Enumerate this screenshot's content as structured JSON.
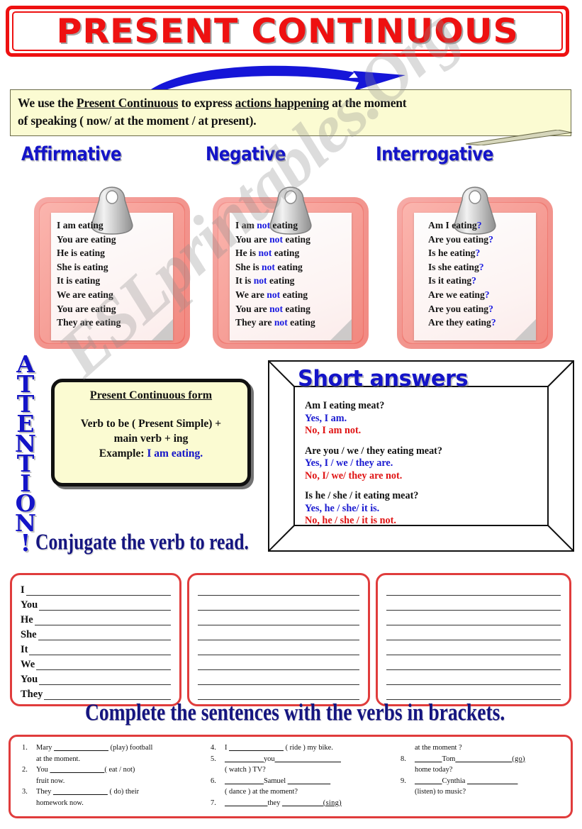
{
  "title": {
    "text": "PRESENT CONTINUOUS"
  },
  "intro": {
    "line1_a": "We use the ",
    "line1_u1": "Present Continuous",
    "line1_b": " to express ",
    "line1_u2": "actions happening",
    "line1_c": " at the moment",
    "line2": "of speaking ( now/ at the moment / at present)."
  },
  "columns": {
    "affirmative": {
      "heading": "Affirmative",
      "lines": [
        "I am eating",
        "You are eating",
        "He is eating",
        "She is eating",
        "It is eating",
        "We are eating",
        "You are eating",
        "They are eating"
      ]
    },
    "negative": {
      "heading": "Negative",
      "rows": [
        {
          "pre": "I  am ",
          "neg": "not",
          "post": " eating"
        },
        {
          "pre": "You  are ",
          "neg": "not",
          "post": " eating"
        },
        {
          "pre": "He  is ",
          "neg": "not",
          "post": " eating"
        },
        {
          "pre": "She  is ",
          "neg": "not",
          "post": " eating"
        },
        {
          "pre": "It  is ",
          "neg": "not",
          "post": " eating"
        },
        {
          "pre": "We are ",
          "neg": "not",
          "post": "  eating"
        },
        {
          "pre": "You  are ",
          "neg": "not",
          "post": " eating"
        },
        {
          "pre": "They  are ",
          "neg": "not",
          "post": " eating"
        }
      ]
    },
    "interrogative": {
      "heading": "Interrogative",
      "rows": [
        {
          "text": "Am I eating",
          "mark": "?"
        },
        {
          "text": "Are you eating",
          "mark": "?"
        },
        {
          "text": "Is he eating",
          "mark": "?"
        },
        {
          "text": "Is she eating",
          "mark": "?"
        },
        {
          "text": "Is it eating",
          "mark": "?"
        },
        {
          "text": "Are we eating",
          "mark": "?"
        },
        {
          "text": "Are you eating",
          "mark": "?"
        },
        {
          "text": "Are they eating",
          "mark": "?"
        }
      ]
    }
  },
  "attention": {
    "letters": "ATTENTION!"
  },
  "form_box": {
    "title": "Present Continuous form",
    "line1": "Verb to be ( Present Simple)  +",
    "line2": "main verb + ing",
    "example_label": "Example: ",
    "example_value": "I am eating."
  },
  "short_answers": {
    "title": "Short answers",
    "groups": [
      {
        "question": "Am I eating meat?",
        "yes": "Yes, I am.",
        "no": "No, I am not."
      },
      {
        "question": "Are you / we / they eating meat?",
        "yes": "Yes, I  / we / they are.",
        "no": "No, I/ we/ they are not."
      },
      {
        "question": "Is  he / she / it eating meat?",
        "yes": "Yes, he / she/ it is.",
        "no": "No, he / she / it is not."
      }
    ]
  },
  "conjugate": {
    "heading": "Conjugate the verb to read.",
    "pronouns": [
      "I",
      "You",
      "He",
      "She",
      "It",
      "We",
      "You",
      "They"
    ],
    "box2_lines": 8,
    "box3_lines": 8
  },
  "complete": {
    "heading": "Complete the sentences with the verbs in brackets.",
    "column1": [
      {
        "num": "1.",
        "line1_a": "Mary ",
        "blank": "______________",
        "line1_b": " (play) football",
        "line2": "at the moment."
      },
      {
        "num": "2.",
        "line1_a": "You ",
        "blank": "______________",
        "line1_b": "( eat / not)",
        "line2": "fruit now."
      },
      {
        "num": "3.",
        "line1_a": "They ",
        "blank": "______________",
        "line1_b": " ( do) their",
        "line2": "homework now."
      }
    ],
    "column2": [
      {
        "num": "4.",
        "line1_a": "I ",
        "blank": "______________",
        "line1_b": " ( ride ) my bike.",
        "line2": ""
      },
      {
        "num": "5.",
        "line1_a": "__________",
        "blank": "you",
        "line1_b": "_________________",
        "line2": "( watch ) TV?"
      },
      {
        "num": "6.",
        "line1_a": "__________",
        "blank": "Samuel ",
        "line1_b": "___________",
        "line2": "( dance ) at the moment?"
      },
      {
        "num": "7.",
        "line1_a": "___________",
        "blank": "they ",
        "line1_b": "__________ (sing)",
        "line2": ""
      }
    ],
    "column3": [
      {
        "num": "",
        "line1_a": "at the moment ?",
        "blank": "",
        "line1_b": "",
        "line2": ""
      },
      {
        "num": "8.",
        "line1_a": "_______",
        "blank": "Tom",
        "line1_b": "______________ (go)",
        "line2": "home today?"
      },
      {
        "num": "9.",
        "line1_a": "_______",
        "blank": "Cynthia ",
        "line1_b": "_____________",
        "line2": "(listen) to music?"
      }
    ]
  },
  "watermark": {
    "text": "ESLprintables.Org"
  },
  "colors": {
    "title_red": "#ee1111",
    "heading_blue": "#1414c8",
    "answer_blue": "#1a1ad0",
    "answer_red": "#e01414",
    "note_yellow": "#fbfbd2",
    "clipboard_pink": "#f08078",
    "box_red": "#e03c3c"
  }
}
